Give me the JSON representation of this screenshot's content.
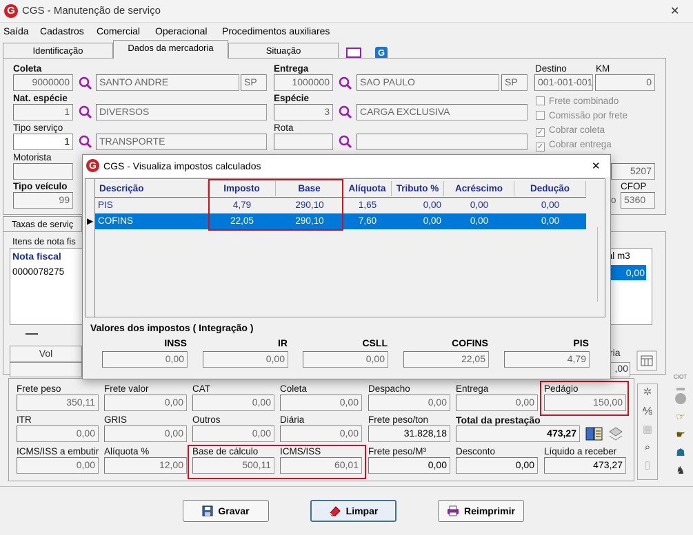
{
  "window": {
    "title": "CGS - Manutenção de serviço",
    "logo": "G",
    "close": "✕"
  },
  "menu": [
    "Saída",
    "Cadastros",
    "Comercial",
    "Operacional",
    "Procedimentos auxiliares"
  ],
  "tabs": [
    "Identificação",
    "Dados da mercadoria",
    "Situação"
  ],
  "coleta": {
    "label": "Coleta",
    "code": "9000000",
    "city": "SANTO ANDRE",
    "uf": "SP"
  },
  "entrega": {
    "label": "Entrega",
    "code": "1000000",
    "city": "SAO PAULO",
    "uf": "SP"
  },
  "destino": {
    "label": "Destino",
    "value": "001-001-001"
  },
  "km": {
    "label": "KM",
    "value": "0"
  },
  "nat_especie": {
    "label": "Nat. espécie",
    "code": "1",
    "name": "DIVERSOS"
  },
  "especie": {
    "label": "Espécie",
    "code": "3",
    "name": "CARGA EXCLUSIVA"
  },
  "tipo_servico": {
    "label": "Tipo serviço",
    "code": "1",
    "name": "TRANSPORTE"
  },
  "rota": {
    "label": "Rota"
  },
  "motorista": {
    "label": "Motorista"
  },
  "tipo_veiculo": {
    "label": "Tipo veículo",
    "code": "99"
  },
  "checks": [
    {
      "label": "Frete combinado",
      "checked": false
    },
    {
      "label": "Comissão por frete",
      "checked": false
    },
    {
      "label": "Cobrar coleta",
      "checked": true
    },
    {
      "label": "Cobrar entrega",
      "checked": true
    }
  ],
  "cfop": {
    "label": "CFOP",
    "value": "5360",
    "partial": "5207",
    "partial_label": "o"
  },
  "subtab": "Taxas de serviç",
  "itens": {
    "group": "Itens de nota fis",
    "col": "Nota fiscal",
    "row": "0000078275",
    "right_col": "tal m3",
    "right_val": "0,00",
    "vol": "Vol",
    "ria": "ria",
    "ria_val": ",00"
  },
  "dialog": {
    "title": "CGS - Visualiza impostos calculados",
    "close": "✕",
    "columns": [
      "Descrição",
      "Imposto",
      "Base",
      "Alíquota",
      "Tributo %",
      "Acréscimo",
      "Dedução"
    ],
    "rows": [
      [
        "PIS",
        "4,79",
        "290,10",
        "1,65",
        "0,00",
        "0,00",
        "0,00"
      ],
      [
        "COFINS",
        "22,05",
        "290,10",
        "7,60",
        "0,00",
        "0,00",
        "0,00"
      ]
    ],
    "group": "Valores dos impostos ( Integração )",
    "taxes": [
      {
        "label": "INSS",
        "value": "0,00"
      },
      {
        "label": "IR",
        "value": "0,00"
      },
      {
        "label": "CSLL",
        "value": "0,00"
      },
      {
        "label": "COFINS",
        "value": "22,05"
      },
      {
        "label": "PIS",
        "value": "4,79"
      }
    ]
  },
  "totals": {
    "row1": [
      {
        "label": "Frete peso",
        "value": "350,11"
      },
      {
        "label": "Frete valor",
        "value": "0,00"
      },
      {
        "label": "CAT",
        "value": "0,00"
      },
      {
        "label": "Coleta",
        "value": "0,00"
      },
      {
        "label": "Despacho",
        "value": "0,00"
      },
      {
        "label": "Entrega",
        "value": "0,00"
      },
      {
        "label": "Pedágio",
        "value": "150,00"
      }
    ],
    "row2": [
      {
        "label": "ITR",
        "value": "0,00"
      },
      {
        "label": "GRIS",
        "value": "0,00"
      },
      {
        "label": "Outros",
        "value": "0,00"
      },
      {
        "label": "Diária",
        "value": "0,00"
      },
      {
        "label": "Frete peso/ton",
        "value": "31.828,18"
      },
      {
        "label": "Total da prestação",
        "value": "473,27"
      }
    ],
    "row3": [
      {
        "label": "ICMS/ISS a embutir",
        "value": "0,00"
      },
      {
        "label": "Alíquota %",
        "value": "12,00"
      },
      {
        "label": "Base de cálculo",
        "value": "500,11"
      },
      {
        "label": "ICMS/ISS",
        "value": "60,01"
      },
      {
        "label": "Frete peso/M³",
        "value": "0,00"
      },
      {
        "label": "Desconto",
        "value": "0,00"
      },
      {
        "label": "Líquido a receber",
        "value": "473,27"
      }
    ]
  },
  "buttons": {
    "gravar": "Gravar",
    "limpar": "Limpar",
    "reimprimir": "Reimprimir"
  },
  "colors": {
    "highlight": "#d0101a",
    "selection": "#0078d7",
    "grid_text": "#1a2b9a"
  }
}
